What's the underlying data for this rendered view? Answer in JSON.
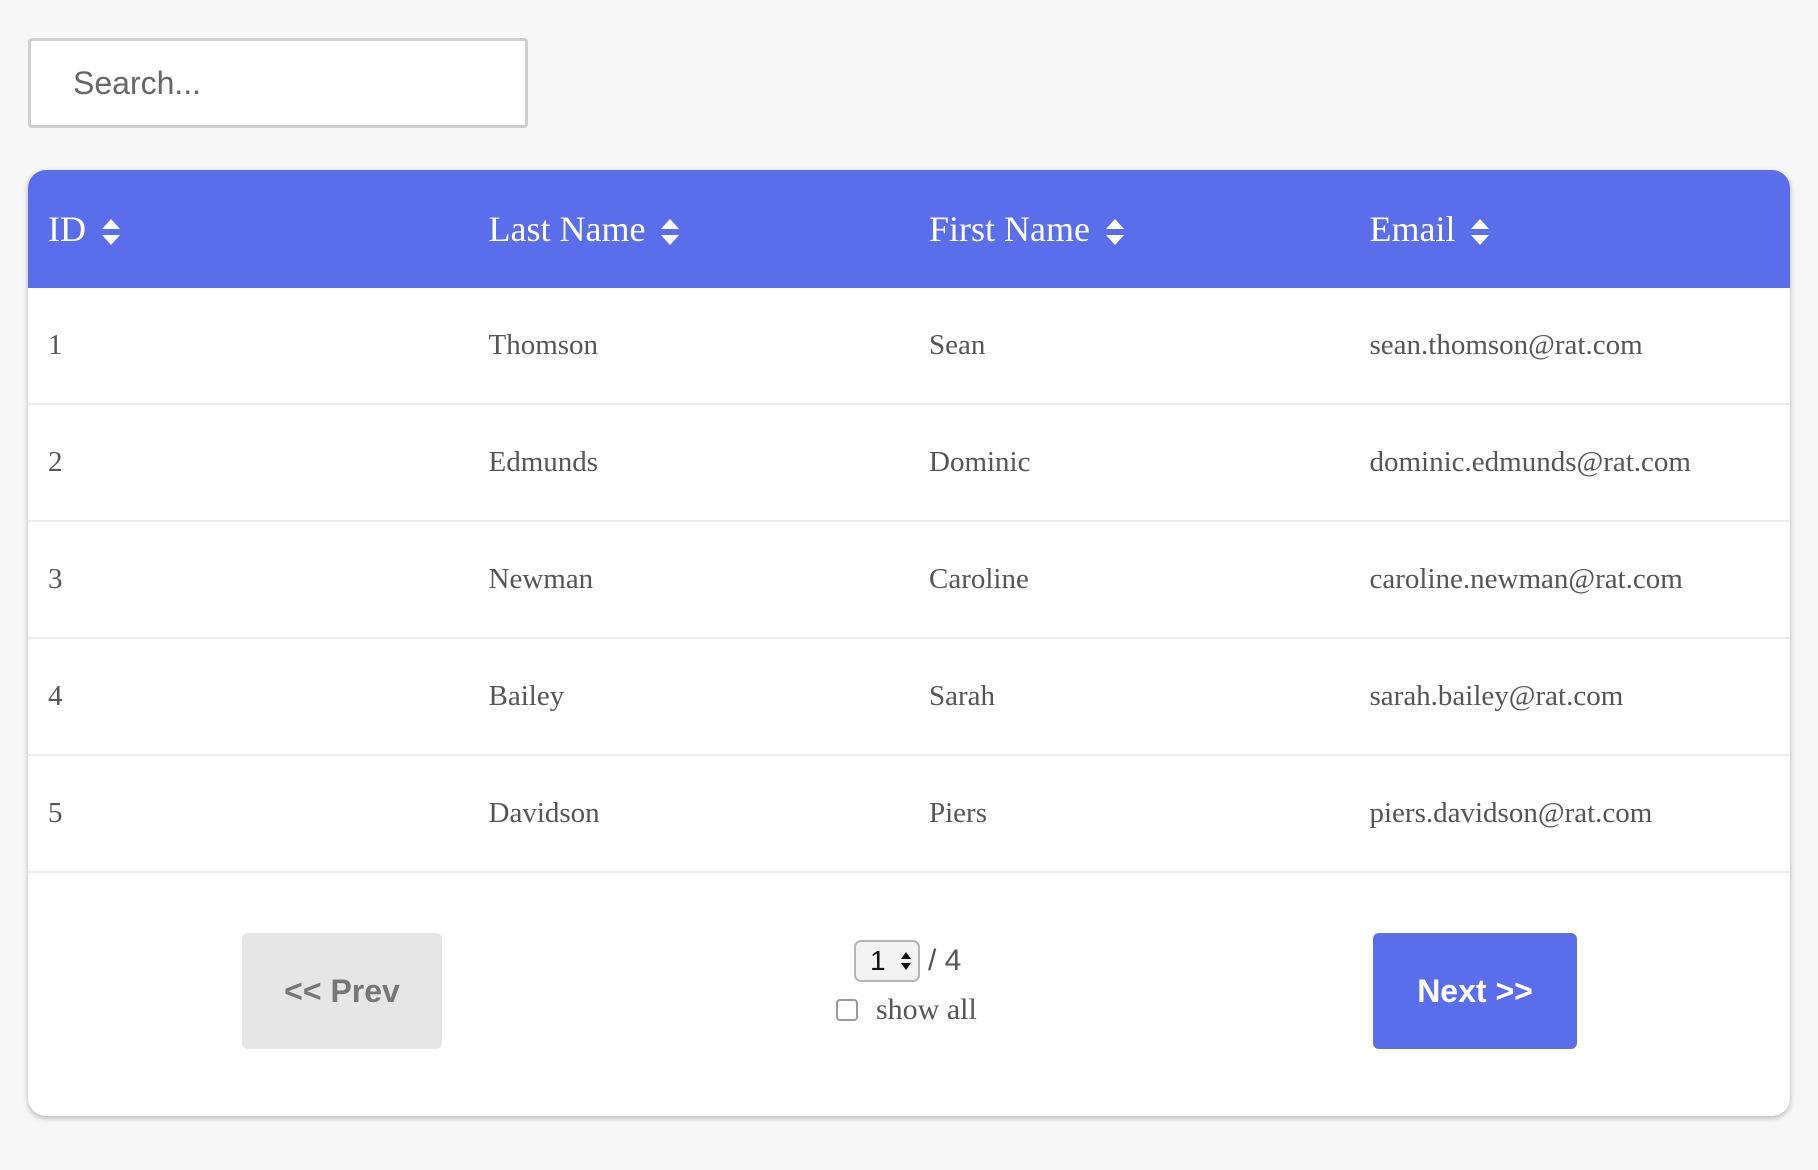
{
  "search": {
    "placeholder": "Search..."
  },
  "table": {
    "columns": [
      {
        "label": "ID"
      },
      {
        "label": "Last Name"
      },
      {
        "label": "First Name"
      },
      {
        "label": "Email"
      }
    ],
    "rows": [
      {
        "id": "1",
        "last_name": "Thomson",
        "first_name": "Sean",
        "email": "sean.thomson@rat.com"
      },
      {
        "id": "2",
        "last_name": "Edmunds",
        "first_name": "Dominic",
        "email": "dominic.edmunds@rat.com"
      },
      {
        "id": "3",
        "last_name": "Newman",
        "first_name": "Caroline",
        "email": "caroline.newman@rat.com"
      },
      {
        "id": "4",
        "last_name": "Bailey",
        "first_name": "Sarah",
        "email": "sarah.bailey@rat.com"
      },
      {
        "id": "5",
        "last_name": "Davidson",
        "first_name": "Piers",
        "email": "piers.davidson@rat.com"
      }
    ]
  },
  "pagination": {
    "prev_label": "<< Prev",
    "next_label": "Next >>",
    "current_page": "1",
    "total_label": "/ 4",
    "show_all_label": "show all",
    "show_all_checked": false
  },
  "icons": {
    "sort": "sort-updown-icon",
    "page_spinner": "spinner-updown-icon"
  },
  "colors": {
    "accent": "#5a6dea",
    "header_text": "#ffffff",
    "body_text": "#555555",
    "prev_bg": "#e6e6e6",
    "page_bg": "#f7f7f7"
  }
}
